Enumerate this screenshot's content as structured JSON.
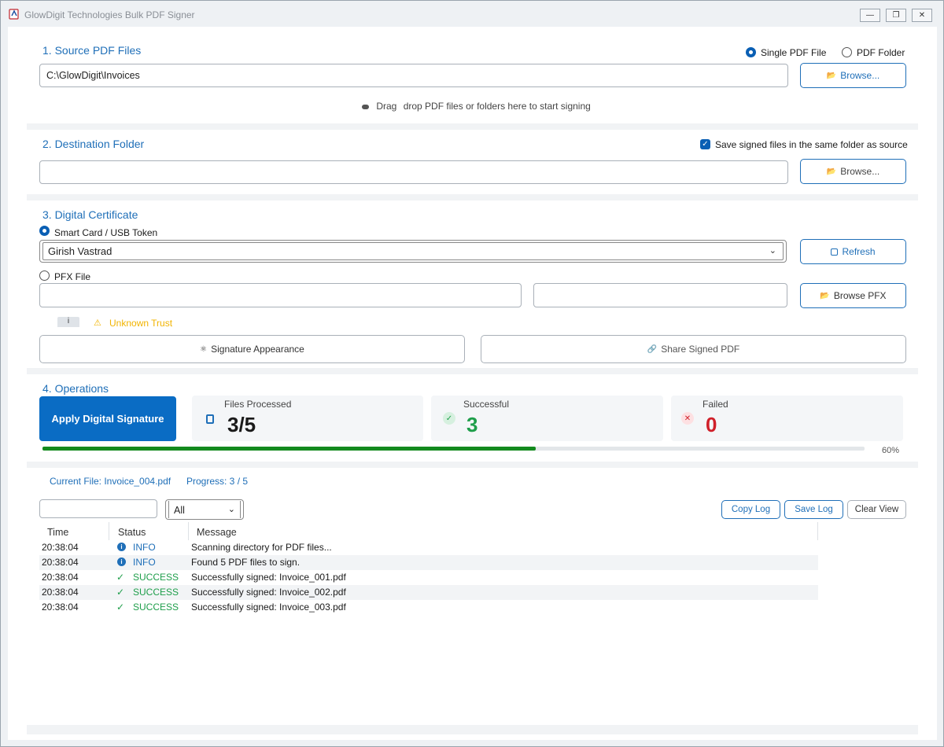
{
  "window": {
    "title": "GlowDigit Technologies Bulk PDF Signer"
  },
  "source": {
    "heading": "1. Source PDF Files",
    "mode_single": "Single PDF File",
    "mode_folder": "PDF Folder",
    "path_value": "C:\\GlowDigit\\Invoices",
    "browse_label": "Browse...",
    "drop_hint_drag": "Drag",
    "drop_hint_rest": "drop PDF files or folders here to start signing"
  },
  "destination": {
    "heading": "2. Destination Folder",
    "same_folder_label": "Save signed files in the same folder as source",
    "path_value": "",
    "browse_label": "Browse..."
  },
  "certificate": {
    "heading": "3. Digital Certificate",
    "smartcard_label": "Smart Card / USB Token",
    "selected_cert": "Girish Vastrad",
    "refresh_label": "Refresh",
    "pfx_label": "PFX File",
    "pfx_path": "",
    "pfx_password": "",
    "browse_pfx_label": "Browse PFX",
    "info_badge": "i",
    "trust_status": "Unknown Trust",
    "appearance_label": "Signature Appearance",
    "share_label": "Share Signed PDF"
  },
  "operations": {
    "heading": "4. Operations",
    "apply_label": "Apply Digital Signature",
    "files_processed_label": "Files Processed",
    "files_processed_value": "3/5",
    "successful_label": "Successful",
    "successful_value": "3",
    "failed_label": "Failed",
    "failed_value": "0",
    "progress_percent": 60,
    "progress_text": "60%"
  },
  "status": {
    "current_file": "Current File: Invoice_004.pdf",
    "progress": "Progress: 3 / 5"
  },
  "log": {
    "search_value": "",
    "filter_value": "All",
    "copy_label": "Copy Log",
    "save_label": "Save Log",
    "clear_label": "Clear View",
    "columns": [
      "Time",
      "Status",
      "Message"
    ],
    "rows": [
      {
        "time": "20:38:04",
        "status": "INFO",
        "message": "Scanning directory for PDF files..."
      },
      {
        "time": "20:38:04",
        "status": "INFO",
        "message": "Found 5 PDF files to sign."
      },
      {
        "time": "20:38:04",
        "status": "SUCCESS",
        "message": "Successfully signed: Invoice_001.pdf"
      },
      {
        "time": "20:38:04",
        "status": "SUCCESS",
        "message": "Successfully signed: Invoice_002.pdf"
      },
      {
        "time": "20:38:04",
        "status": "SUCCESS",
        "message": "Successfully signed: Invoice_003.pdf"
      }
    ]
  },
  "colors": {
    "accent": "#0a6cc4",
    "heading": "#1f6fb8",
    "success": "#1e9e4a",
    "failed": "#d0202a",
    "info": "#1f6fb8",
    "warning": "#f2b400"
  }
}
